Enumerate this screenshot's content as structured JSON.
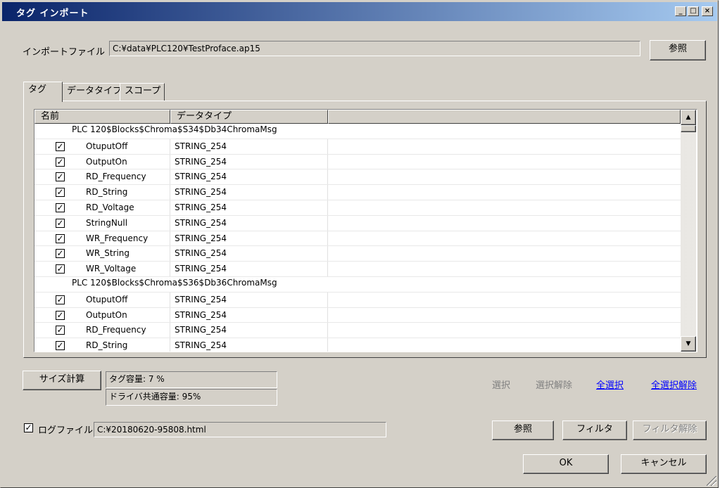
{
  "window": {
    "title": "タグ インポート",
    "controls": {
      "minimize": "_",
      "maximize": "□",
      "close": "×"
    }
  },
  "import_file": {
    "label": "インポートファイル",
    "value": "C:¥data¥PLC120¥TestProface.ap15",
    "browse_label": "参照"
  },
  "tabs": [
    {
      "label": "タグ",
      "active": true
    },
    {
      "label": "データタイプ",
      "active": false
    },
    {
      "label": "スコープ",
      "active": false
    }
  ],
  "grid": {
    "headers": [
      "名前",
      "データタイプ",
      ""
    ],
    "check_glyph": "✓",
    "rows": [
      {
        "kind": "group",
        "name": "PLC 120$Blocks$Chroma$S34$Db34ChromaMsg"
      },
      {
        "kind": "item",
        "checked": true,
        "name": "OtuputOff",
        "type": "STRING_254"
      },
      {
        "kind": "item",
        "checked": true,
        "name": "OutputOn",
        "type": "STRING_254"
      },
      {
        "kind": "item",
        "checked": true,
        "name": "RD_Frequency",
        "type": "STRING_254"
      },
      {
        "kind": "item",
        "checked": true,
        "name": "RD_String",
        "type": "STRING_254"
      },
      {
        "kind": "item",
        "checked": true,
        "name": "RD_Voltage",
        "type": "STRING_254"
      },
      {
        "kind": "item",
        "checked": true,
        "name": "StringNull",
        "type": "STRING_254"
      },
      {
        "kind": "item",
        "checked": true,
        "name": "WR_Frequency",
        "type": "STRING_254"
      },
      {
        "kind": "item",
        "checked": true,
        "name": "WR_String",
        "type": "STRING_254"
      },
      {
        "kind": "item",
        "checked": true,
        "name": "WR_Voltage",
        "type": "STRING_254"
      },
      {
        "kind": "group",
        "name": "PLC 120$Blocks$Chroma$S36$Db36ChromaMsg"
      },
      {
        "kind": "item",
        "checked": true,
        "name": "OtuputOff",
        "type": "STRING_254"
      },
      {
        "kind": "item",
        "checked": true,
        "name": "OutputOn",
        "type": "STRING_254"
      },
      {
        "kind": "item",
        "checked": true,
        "name": "RD_Frequency",
        "type": "STRING_254"
      },
      {
        "kind": "item",
        "checked": true,
        "name": "RD_String",
        "type": "STRING_254"
      }
    ],
    "scroll_up": "▲",
    "scroll_down": "▼"
  },
  "size": {
    "button_label": "サイズ計算",
    "tag_capacity": "タグ容量: 7 %",
    "driver_capacity": "ドライバ共通容量: 95%"
  },
  "selection": {
    "select": "選択",
    "deselect": "選択解除",
    "select_all": "全選択",
    "deselect_all": "全選択解除"
  },
  "log": {
    "checked": true,
    "label": "ログファイル",
    "value": "C:¥20180620-95808.html",
    "browse_label": "参照",
    "filter_label": "フィルタ",
    "clear_filter_label": "フィルタ解除"
  },
  "footer": {
    "ok_label": "OK",
    "cancel_label": "キャンセル"
  },
  "colors": {
    "title_bar_start": "#0a246a",
    "title_bar_end": "#a6caf0",
    "face": "#d4d0c8",
    "link": "#0000ff",
    "disabled_text": "#808080"
  }
}
